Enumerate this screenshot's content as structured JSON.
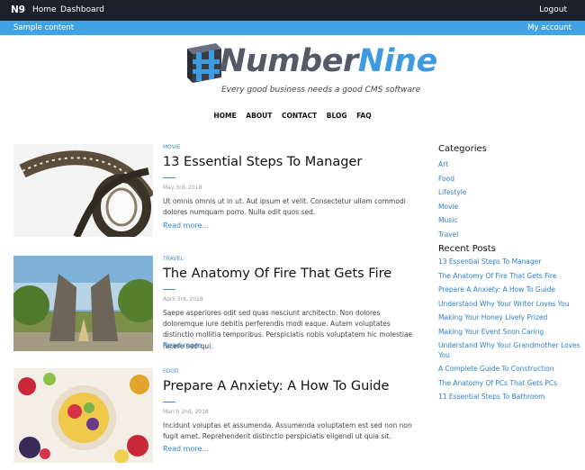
{
  "topbar": {
    "brand": "N9",
    "nav": [
      "Home",
      "Dashboard"
    ],
    "logout": "Logout"
  },
  "subbar": {
    "left": "Sample content",
    "right": "My account"
  },
  "logo": {
    "word_part1": "Number",
    "word_part2": "Nine",
    "tagline": "Every good business needs a good CMS software"
  },
  "main_nav": [
    "HOME",
    "ABOUT",
    "CONTACT",
    "BLOG",
    "FAQ"
  ],
  "posts": [
    {
      "category": "MOVIE",
      "title": "13 Essential Steps To Manager",
      "date": "May 3rd, 2018",
      "excerpt": "Ut omnis omnis ut in ut. Aut ipsum et velit. Consectetur ullam commodi dolores numquam porro. Nulla odit quos sed.",
      "read_more": "Read more..."
    },
    {
      "category": "TRAVEL",
      "title": "The Anatomy Of Fire That Gets Fire",
      "date": "April 3rd, 2018",
      "excerpt": "Saepe asperiores odit sed quas nesciunt architecto. Non dolores doloremque iure debitis perferendis modi eaque. Autem voluptates distinctio mollitia temporibus. Perspiciatis nobis voluptatem hic molestiae facere sed qui.",
      "read_more": "Read more..."
    },
    {
      "category": "FOOD",
      "title": "Prepare A Anxiety: A How To Guide",
      "date": "March 2nd, 2018",
      "excerpt": "Incidunt voluptas et assumenda. Assumenda voluptatem est sed non non fugit amet. Reprehenderit distinctio perspiciatis eligendi ut quia sit.",
      "read_more": "Read more..."
    }
  ],
  "sidebar": {
    "categories_title": "Categories",
    "categories": [
      "Art",
      "Food",
      "Lifestyle",
      "Movie",
      "Music",
      "Travel"
    ],
    "recent_title": "Recent Posts",
    "recent": [
      "13 Essential Steps To Manager",
      "The Anatomy Of Fire That Gets Fire",
      "Prepare A Anxiety: A How To Guide",
      "Understand Why Your Writer Loves You",
      "Making Your Honey Lively Prized",
      "Making Your Event Soon Caring",
      "Understand Why Your Grandmother Loves You",
      "A Complete Guide To Construction",
      "The Anatomy Of PCs That Gets PCs",
      "11 Essential Steps To Bathroom"
    ]
  },
  "colors": {
    "topbar": "#1e2129",
    "subbar": "#3fa3e6",
    "link": "#2f7fc7",
    "logo_dark": "#555a66",
    "logo_blue": "#3f9be0"
  }
}
